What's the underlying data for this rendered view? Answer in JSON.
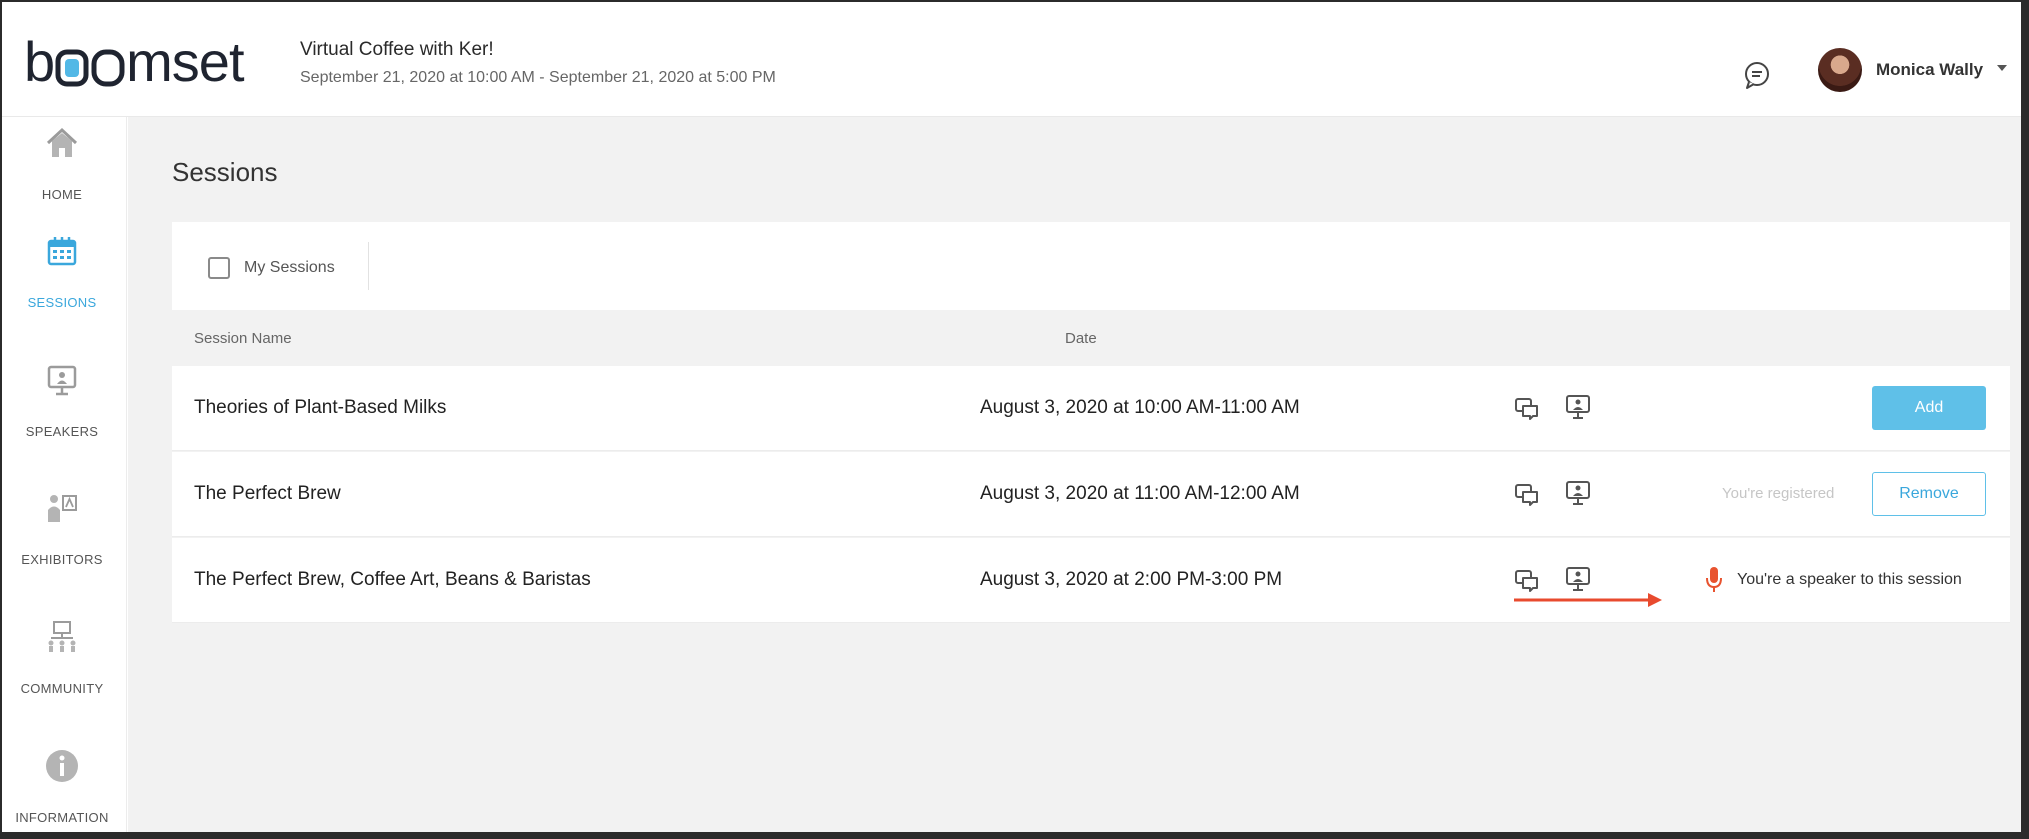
{
  "header": {
    "logo_text_start": "b",
    "logo_text_end": "mset",
    "event_title": "Virtual Coffee with Ker!",
    "event_dates": "September 21, 2020 at 10:00 AM - September 21, 2020 at 5:00 PM",
    "user_name": "Monica Wally",
    "chat_icon": "chat-bubble-icon",
    "user_menu_icon": "caret-down-icon"
  },
  "sidebar": {
    "items": [
      {
        "label": "HOME",
        "icon": "home-icon",
        "active": false
      },
      {
        "label": "SESSIONS",
        "icon": "calendar-icon",
        "active": true
      },
      {
        "label": "SPEAKERS",
        "icon": "presentation-icon",
        "active": false
      },
      {
        "label": "EXHIBITORS",
        "icon": "exhibitor-icon",
        "active": false
      },
      {
        "label": "COMMUNITY",
        "icon": "community-icon",
        "active": false
      },
      {
        "label": "INFORMATION",
        "icon": "info-icon",
        "active": false
      }
    ]
  },
  "main": {
    "page_title": "Sessions",
    "filter": {
      "my_sessions_label": "My Sessions",
      "checked": false
    },
    "columns": {
      "name": "Session Name",
      "date": "Date"
    },
    "rows": [
      {
        "name": "Theories of Plant-Based Milks",
        "date": "August 3, 2020 at 10:00 AM-11:00 AM",
        "action_label": "Add"
      },
      {
        "name": "The Perfect Brew",
        "date": "August 3, 2020 at 11:00 AM-12:00 AM",
        "status_text": "You're registered",
        "action_label": "Remove"
      },
      {
        "name": "The Perfect Brew, Coffee Art, Beans & Baristas",
        "date": "August 3, 2020 at 2:00 PM-3:00 PM",
        "speaker_text": "You're a speaker to this session",
        "speaker_icon": "microphone-icon"
      }
    ]
  },
  "colors": {
    "accent": "#3aa7dc",
    "button": "#5fc0e8",
    "speaker": "#e8532f",
    "annotation_arrow": "#e84a2e"
  }
}
